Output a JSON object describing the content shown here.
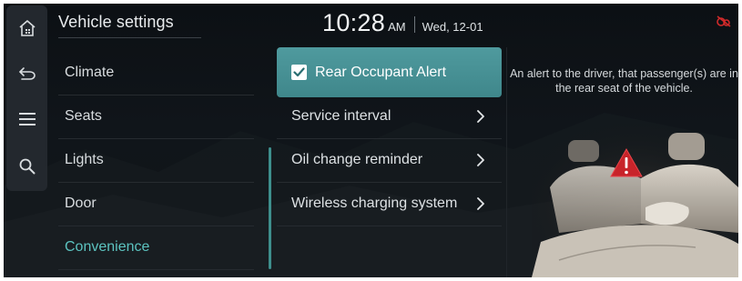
{
  "header": {
    "title": "Vehicle settings",
    "time": "10:28",
    "ampm": "AM",
    "date": "Wed, 12-01"
  },
  "rail": {
    "icons": [
      "home-icon",
      "back-icon",
      "menu-icon",
      "search-icon"
    ]
  },
  "categories": [
    {
      "label": "Climate",
      "active": false
    },
    {
      "label": "Seats",
      "active": false
    },
    {
      "label": "Lights",
      "active": false
    },
    {
      "label": "Door",
      "active": false
    },
    {
      "label": "Convenience",
      "active": true
    }
  ],
  "options": [
    {
      "label": "Rear Occupant Alert",
      "type": "checkbox",
      "checked": true,
      "selected": true
    },
    {
      "label": "Service interval",
      "type": "submenu"
    },
    {
      "label": "Oil change reminder",
      "type": "submenu"
    },
    {
      "label": "Wireless charging system",
      "type": "submenu"
    }
  ],
  "description": "An alert to the driver, that passenger(s) are in the rear seat of the vehicle.",
  "colors": {
    "accent": "#5cc3c0",
    "selected_bg": "#4a959a",
    "status_icon": "#d22a2a",
    "warning": "#c8242a"
  }
}
